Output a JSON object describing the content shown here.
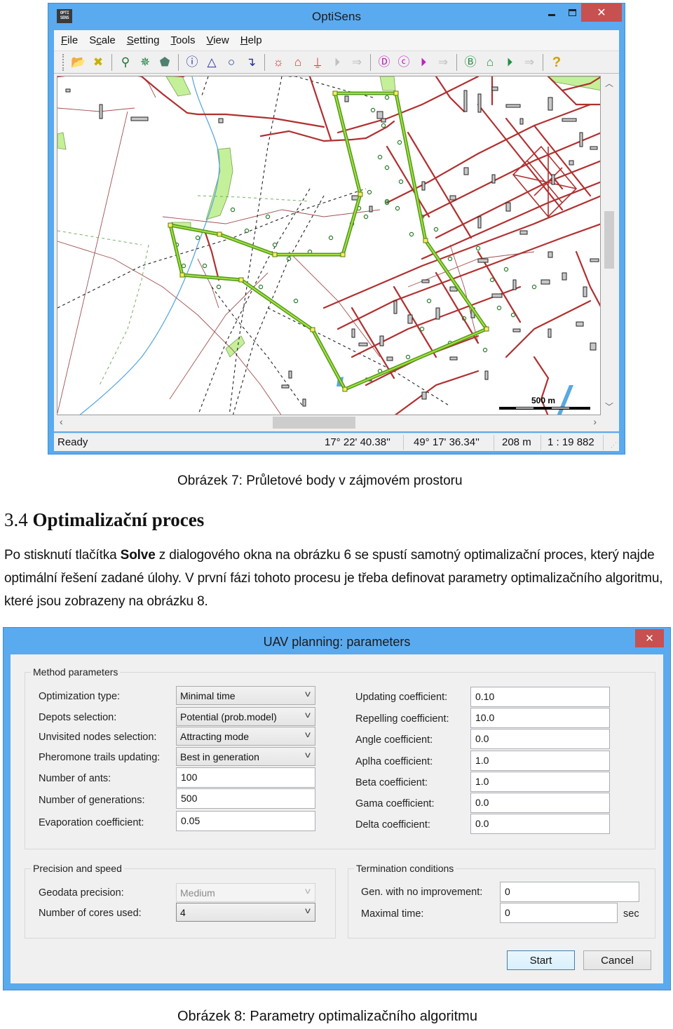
{
  "figure7": {
    "window_title": "OptiSens",
    "app_logo_text": "OPTI SENS",
    "window_controls": {
      "minimize": "minimize",
      "maximize": "maximize",
      "close": "✕"
    },
    "menu": [
      {
        "label": "File",
        "mnemonic": "F"
      },
      {
        "label": "Scale",
        "mnemonic": "c"
      },
      {
        "label": "Setting",
        "mnemonic": "S"
      },
      {
        "label": "Tools",
        "mnemonic": "T"
      },
      {
        "label": "View",
        "mnemonic": "V"
      },
      {
        "label": "Help",
        "mnemonic": "H"
      }
    ],
    "toolbar": [
      {
        "icon": "open-folder-icon",
        "glyph": "📂",
        "color": "#c8a020"
      },
      {
        "icon": "close-x-icon",
        "glyph": "✖",
        "color": "#c8b000"
      },
      {
        "icon": "zoom-dropdown-icon",
        "glyph": "⚲",
        "color": "#207030"
      },
      {
        "icon": "layers-dropdown-icon",
        "glyph": "✵",
        "color": "#208040"
      },
      {
        "icon": "area-dropdown-icon",
        "glyph": "⬟",
        "color": "#508070"
      },
      {
        "icon": "info-icon",
        "glyph": "ⓘ",
        "color": "#2030a0"
      },
      {
        "icon": "triangle-icon",
        "glyph": "△",
        "color": "#2030a0"
      },
      {
        "icon": "circle-icon",
        "glyph": "○",
        "color": "#2030a0"
      },
      {
        "icon": "route-icon",
        "glyph": "↴",
        "color": "#2030a0"
      },
      {
        "icon": "sun-icon",
        "glyph": "☼",
        "color": "#e03030"
      },
      {
        "icon": "polygon-red-icon",
        "glyph": "⌂",
        "color": "#e03030"
      },
      {
        "icon": "depot-red-icon",
        "glyph": "⍊",
        "color": "#e03030"
      },
      {
        "icon": "step-disabled-icon",
        "glyph": "⏵",
        "color": "#c0c0c0"
      },
      {
        "icon": "arrow-disabled-icon",
        "glyph": "⇒",
        "color": "#c0c0c0"
      },
      {
        "icon": "d-magenta-icon",
        "glyph": "Ⓓ",
        "color": "#c020c0"
      },
      {
        "icon": "c-magenta-icon",
        "glyph": "ⓒ",
        "color": "#c020c0"
      },
      {
        "icon": "step-magenta-icon",
        "glyph": "⏵",
        "color": "#c020c0"
      },
      {
        "icon": "arrow-disabled-icon",
        "glyph": "⇒",
        "color": "#c0c0c0"
      },
      {
        "icon": "b-green-icon",
        "glyph": "Ⓑ",
        "color": "#209040"
      },
      {
        "icon": "polygon-green-icon",
        "glyph": "⌂",
        "color": "#209040"
      },
      {
        "icon": "step-green-icon",
        "glyph": "⏵",
        "color": "#209040"
      },
      {
        "icon": "arrow-disabled-icon",
        "glyph": "⇒",
        "color": "#c0c0c0"
      },
      {
        "icon": "help-icon",
        "glyph": "?",
        "color": "#d0a000"
      }
    ],
    "map": {
      "scale_bar_label": "500 m",
      "colors": {
        "roads": "#b03030",
        "route": "#60c020",
        "waypoint": "#f0f060",
        "water": "#5aa8e0",
        "forest": "#c0f090",
        "paths": "#222222"
      }
    },
    "status": {
      "state": "Ready",
      "longitude": "17° 22' 40.38''",
      "latitude": "49° 17' 36.34''",
      "distance": "208 m",
      "scale": "1 : 19 882"
    },
    "caption": "Obrázek 7: Průletové body v zájmovém prostoru"
  },
  "section": {
    "number": "3.4",
    "title": "Optimalizační proces",
    "paragraph_before_bold": "Po stisknutí tlačítka ",
    "paragraph_bold": "Solve",
    "paragraph_after_bold": " z dialogového okna na obrázku 6 se spustí samotný optimalizační proces, který najde optimální řešení zadané úlohy. V první fázi tohoto procesu je třeba definovat parametry optimalizačního algoritmu, které jsou zobrazeny na obrázku 8."
  },
  "figure8": {
    "window_title": "UAV planning: parameters",
    "close_glyph": "✕",
    "method_group": {
      "title": "Method parameters",
      "left": [
        {
          "label": "Optimization type:",
          "type": "combo",
          "value": "Minimal time"
        },
        {
          "label": "Depots selection:",
          "type": "combo",
          "value": "Potential (prob.model)"
        },
        {
          "label": "Unvisited nodes selection:",
          "type": "combo",
          "value": "Attracting mode"
        },
        {
          "label": "Pheromone trails updating:",
          "type": "combo",
          "value": "Best in generation"
        },
        {
          "label": "Number of ants:",
          "type": "text",
          "value": "100"
        },
        {
          "label": "Number of generations:",
          "type": "text",
          "value": "500"
        },
        {
          "label": "Evaporation coefficient:",
          "type": "text",
          "value": "0.05"
        }
      ],
      "right": [
        {
          "label": "Updating coefficient:",
          "value": "0.10"
        },
        {
          "label": "Repelling coefficient:",
          "value": "10.0"
        },
        {
          "label": "Angle coefficient:",
          "value": "0.0"
        },
        {
          "label": "Aplha coefficient:",
          "value": "1.0"
        },
        {
          "label": "Beta coefficient:",
          "value": "1.0"
        },
        {
          "label": "Gama coefficient:",
          "value": "0.0"
        },
        {
          "label": "Delta coefficient:",
          "value": "0.0"
        }
      ]
    },
    "precision_group": {
      "title": "Precision and speed",
      "geodata_label": "Geodata precision:",
      "geodata_value": "Medium",
      "cores_label": "Number of cores used:",
      "cores_value": "4"
    },
    "termination_group": {
      "title": "Termination conditions",
      "gen_label": "Gen. with no improvement:",
      "gen_value": "0",
      "time_label": "Maximal time:",
      "time_value": "0",
      "time_unit": "sec"
    },
    "buttons": {
      "start": "Start",
      "cancel": "Cancel"
    },
    "caption": "Obrázek 8: Parametry optimalizačního algoritmu"
  }
}
